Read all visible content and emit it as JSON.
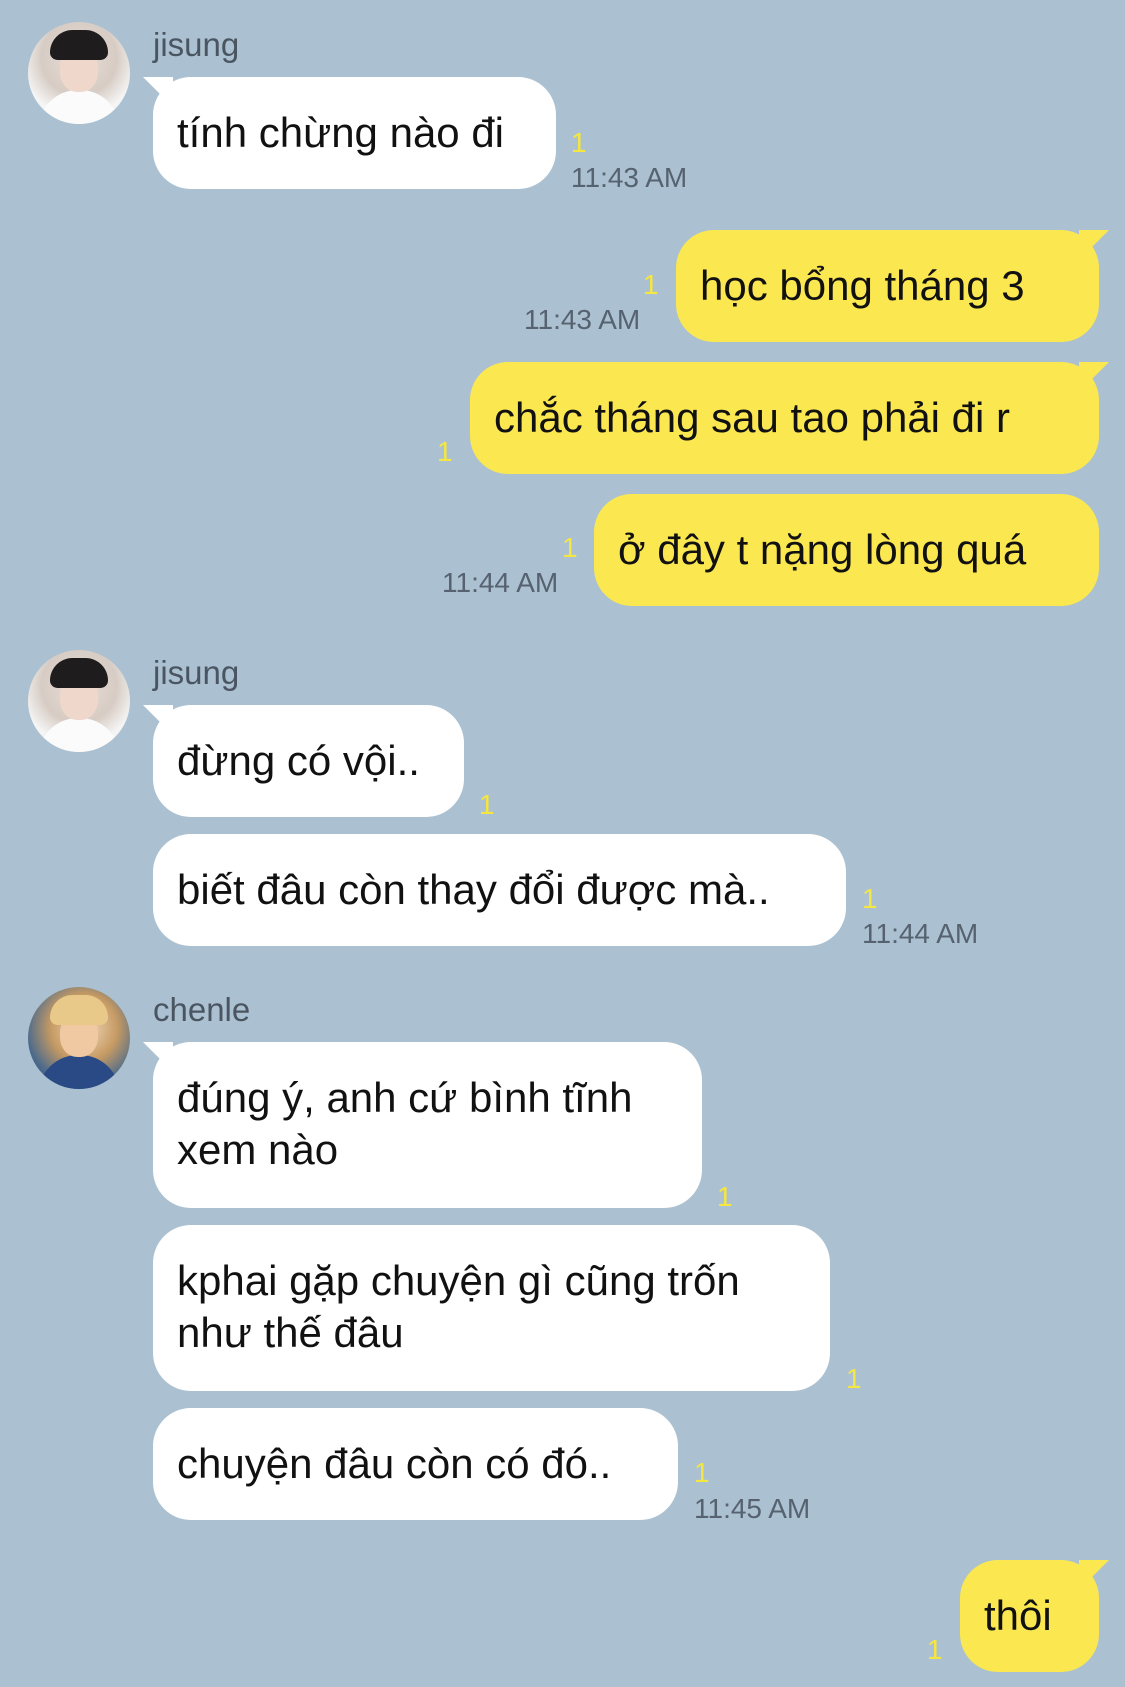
{
  "colors": {
    "background": "#abc1d1",
    "incoming_bubble": "#ffffff",
    "outgoing_bubble": "#fbe74f",
    "unread": "#f5e641"
  },
  "senders": {
    "jisung": "jisung",
    "chenle": "chenle"
  },
  "messages": {
    "m1": {
      "text": "tính chừng nào đi",
      "unread": "1",
      "time": "11:43 AM"
    },
    "m2": {
      "text": "học bổng tháng 3",
      "unread": "1",
      "time": "11:43 AM"
    },
    "m3": {
      "text": "chắc tháng sau tao phải đi r",
      "unread": "1"
    },
    "m4": {
      "text": "ở đây t nặng lòng quá",
      "unread": "1",
      "time": "11:44 AM"
    },
    "m5": {
      "text": "đừng có vội..",
      "unread": "1"
    },
    "m6": {
      "text": "biết đâu còn thay đổi được mà..",
      "unread": "1",
      "time": "11:44 AM"
    },
    "m7": {
      "text": "đúng ý, anh cứ bình tĩnh\nxem nào",
      "unread": "1"
    },
    "m8": {
      "text": "kphai gặp chuyện gì cũng trốn\nnhư thế đâu",
      "unread": "1"
    },
    "m9": {
      "text": "chuyện đâu còn có đó..",
      "unread": "1",
      "time": "11:45 AM"
    },
    "m10": {
      "text": "thôi",
      "unread": "1"
    }
  }
}
